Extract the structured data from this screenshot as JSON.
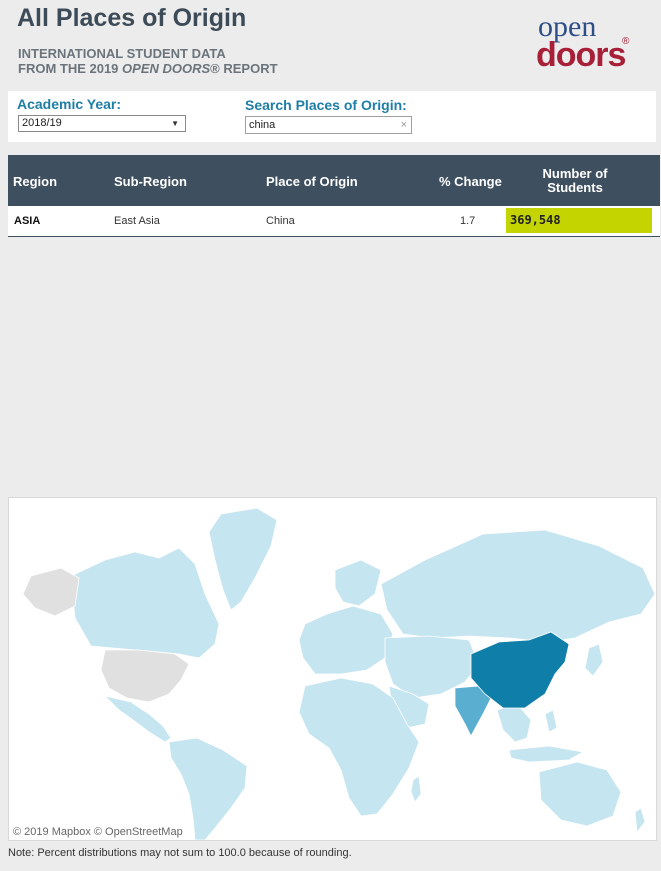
{
  "header": {
    "title": "All Places of Origin",
    "subtitle_line1": "INTERNATIONAL STUDENT DATA",
    "subtitle_prefix": "FROM THE 2019 ",
    "subtitle_italic": "OPEN DOORS",
    "subtitle_suffix": "® REPORT",
    "logo_top": "open",
    "logo_bottom": "doors",
    "logo_reg": "®"
  },
  "filters": {
    "academic_year_label": "Academic Year:",
    "academic_year_value": "2018/19",
    "search_label": "Search Places of Origin:",
    "search_value": "china",
    "clear_glyph": "×",
    "dropdown_glyph": "▼"
  },
  "table": {
    "headers": {
      "region": "Region",
      "sub_region": "Sub-Region",
      "place": "Place of Origin",
      "pct_change": "% Change",
      "students_line1": "Number of",
      "students_line2": "Students"
    },
    "rows": [
      {
        "region": "ASIA",
        "sub_region": "East Asia",
        "place": "China",
        "pct_change": "1.7",
        "students": "369,548"
      }
    ]
  },
  "map": {
    "attribution": "© 2019 Mapbox © OpenStreetMap",
    "colors": {
      "land": "#c5e5f0",
      "excluded": "#e0e0e0",
      "highlight": "#0f7ea8",
      "secondary": "#5aaed0"
    }
  },
  "footer": {
    "note": "Note: Percent distributions may not sum to 100.0 because of rounding."
  }
}
